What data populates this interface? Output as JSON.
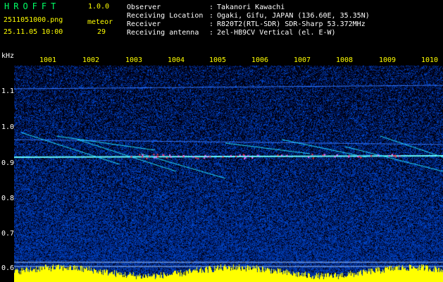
{
  "app": {
    "name": "HROFFT",
    "version": "1.0.0"
  },
  "file": {
    "name": "2511051000.png",
    "datetime": "25.11.05 10:00"
  },
  "meteor": {
    "label": "meteor",
    "count": "29"
  },
  "info": [
    {
      "label": "Observer",
      "sep": ":",
      "value": "Takanori Kawachi"
    },
    {
      "label": "Receiving Location",
      "sep": ":",
      "value": "Ogaki, Gifu, JAPAN (136.60E, 35.35N)"
    },
    {
      "label": "Receiver",
      "sep": ":",
      "value": "R820T2(RTL-SDR) SDR-Sharp 53.372MHz"
    },
    {
      "label": "Receiving antenna",
      "sep": ":",
      "value": "2el-HB9CV Vertical (el. E-W)"
    }
  ],
  "axis": {
    "y_unit": "kHz",
    "y_ticks": [
      "1.1",
      "1.0",
      "0.9",
      "0.8",
      "0.7",
      "0.6"
    ],
    "x_ticks": [
      "1001",
      "1002",
      "1003",
      "1004",
      "1005",
      "1006",
      "1007",
      "1008",
      "1009",
      "1010"
    ]
  },
  "colors": {
    "background": "#000000",
    "noise": "#001a80",
    "trace": "#00ffff",
    "strong": "#ff3333",
    "baseline": "#ffff00"
  }
}
